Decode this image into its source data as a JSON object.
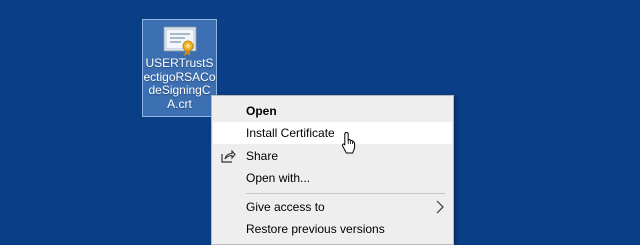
{
  "desktop": {
    "background": "#0a3f87",
    "file_icon": {
      "name": "USERTrustSectigoRSACodeSigningCA.crt",
      "icon": "certificate-icon"
    }
  },
  "context_menu": {
    "items": [
      {
        "label": "Open",
        "bold": true
      },
      {
        "label": "Install Certificate",
        "highlighted": true
      },
      {
        "label": "Share",
        "icon": "share-icon"
      },
      {
        "label": "Open with..."
      },
      {
        "label": "Give access to",
        "submenu": true
      },
      {
        "label": "Restore previous versions"
      }
    ]
  },
  "pointer": {
    "icon": "mouse-pointer-icon"
  }
}
